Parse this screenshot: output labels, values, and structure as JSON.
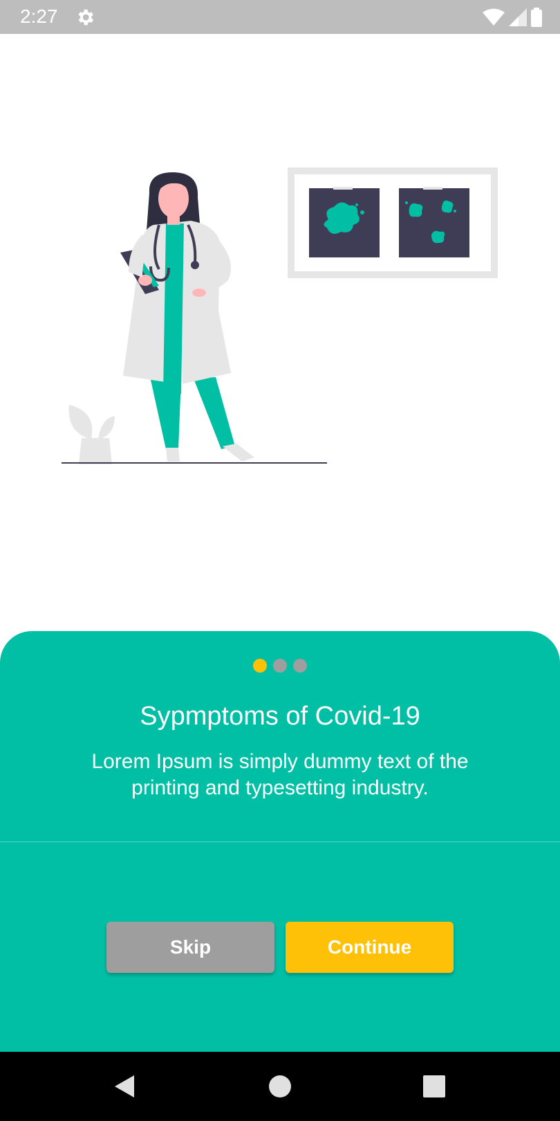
{
  "status_bar": {
    "time": "2:27",
    "icons": [
      "gear-icon",
      "wifi-icon",
      "signal-icon",
      "battery-icon"
    ]
  },
  "onboarding": {
    "page_indicator": {
      "total": 3,
      "active_index": 0
    },
    "title": "Sypmptoms of Covid-19",
    "description": "Lorem Ipsum is simply dummy text of the printing and typesetting industry.",
    "skip_label": "Skip",
    "continue_label": "Continue"
  },
  "nav_bar": {
    "icons": [
      "back-icon",
      "home-icon",
      "recents-icon"
    ]
  },
  "colors": {
    "accent": "#00bfa5",
    "button_primary": "#ffc107",
    "button_secondary": "#9e9e9e",
    "illustration_dark": "#3f3d56",
    "illustration_light": "#e6e6e6"
  }
}
